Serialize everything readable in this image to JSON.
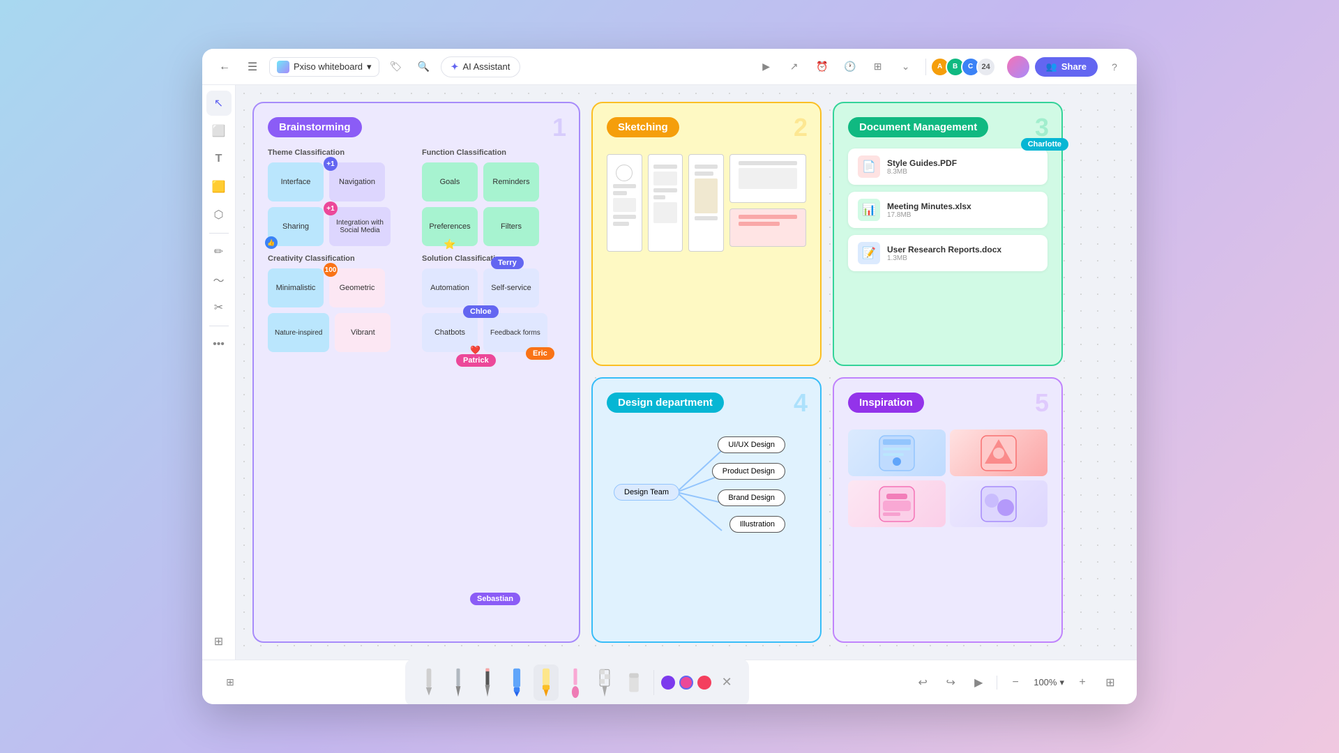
{
  "app": {
    "name": "Pxiso whiteboard",
    "ai_label": "AI Assistant"
  },
  "toolbar": {
    "share_label": "Share",
    "avatar_count": "24",
    "zoom_level": "100%"
  },
  "frames": {
    "brainstorm": {
      "title": "Brainstorming",
      "number": "1",
      "theme_classification": {
        "label": "Theme Classification",
        "items": [
          "Interface",
          "Navigation",
          "Sharing",
          "Integration with Social Media"
        ]
      },
      "function_classification": {
        "label": "Function Classification",
        "items": [
          "Goals",
          "Reminders",
          "Preferences",
          "Filters"
        ]
      },
      "creativity_classification": {
        "label": "Creativity Classification",
        "items": [
          "Minimalistic",
          "Geometric",
          "Nature-inspired",
          "Vibrant"
        ]
      },
      "solution_classification": {
        "label": "Solution Classification",
        "items": [
          "Automation",
          "Self-service",
          "Chatbots",
          "Feedback forms"
        ]
      },
      "users": {
        "terry": "Terry",
        "chloe": "Chloe",
        "patrick": "Patrick",
        "eric": "Eric",
        "sebastian": "Sebastian"
      }
    },
    "sketch": {
      "title": "Sketching",
      "number": "2"
    },
    "docs": {
      "title": "Document Management",
      "number": "3",
      "files": [
        {
          "name": "Style Guides.PDF",
          "size": "8.3MB",
          "type": "pdf"
        },
        {
          "name": "Meeting Minutes.xlsx",
          "size": "17.8MB",
          "type": "xlsx"
        },
        {
          "name": "User Research Reports.docx",
          "size": "1.3MB",
          "type": "docx"
        }
      ],
      "users": {
        "charlotte": "Charlotte"
      }
    },
    "design": {
      "title": "Design department",
      "number": "4",
      "center_node": "Design Team",
      "nodes": [
        "UI/UX Design",
        "Product Design",
        "Brand Design",
        "Illustration"
      ]
    },
    "inspiration": {
      "title": "Inspiration",
      "number": "5"
    }
  },
  "bottom_tools": {
    "pens": [
      "fountain-pen-light",
      "ballpoint-light",
      "pencil-dark",
      "marker-blue",
      "highlighter-yellow",
      "brush-pink",
      "pattern-checker",
      "eraser"
    ],
    "colors": [
      "#7c3aed",
      "#ec4899",
      "#f43f5e"
    ],
    "close_label": "×",
    "zoom": "100%"
  },
  "left_sidebar": {
    "tools": [
      "cursor",
      "frame",
      "text",
      "sticky",
      "shape",
      "pen",
      "scissors",
      "more"
    ]
  }
}
